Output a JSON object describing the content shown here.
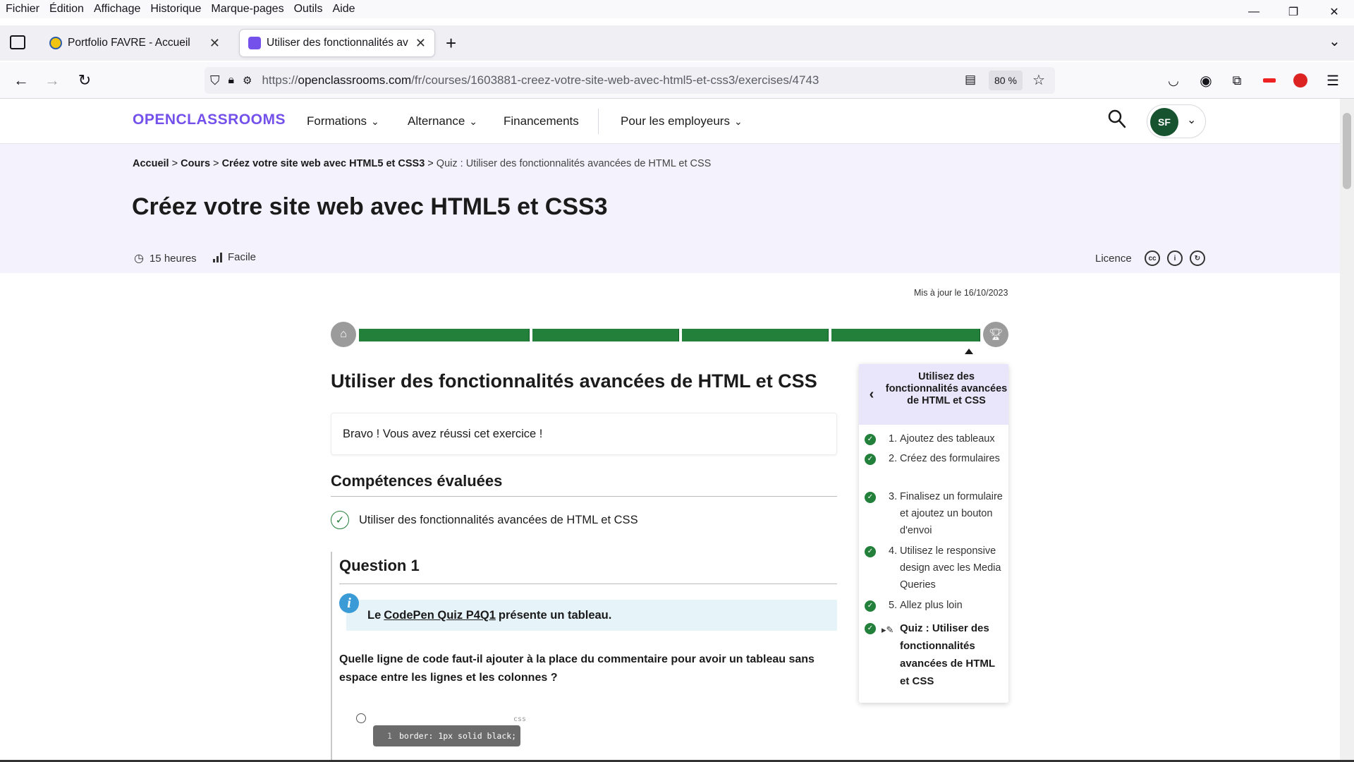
{
  "menu": [
    "Fichier",
    "Édition",
    "Affichage",
    "Historique",
    "Marque-pages",
    "Outils",
    "Aide"
  ],
  "window": {
    "minimize": "—",
    "restore": "❐",
    "close": "✕"
  },
  "tabs": [
    {
      "title": "Portfolio FAVRE - Accueil",
      "favicon_color": "#f1c40f"
    },
    {
      "title": "Utiliser des fonctionnalités avancées de HTML et CSS",
      "favicon_color": "#7451eb"
    }
  ],
  "urlbar": {
    "prefix": "https://",
    "domain": "openclassrooms.com",
    "path": "/fr/courses/1603881-creez-votre-site-web-avec-html5-et-css3/exercises/4743",
    "zoom": "80 %"
  },
  "header": {
    "logo": "OPENCLASSROOMS",
    "nav": [
      "Formations",
      "Alternance",
      "Financements",
      "Pour les employeurs"
    ],
    "avatar_initials": "SF"
  },
  "hero": {
    "breadcrumb": [
      "Accueil",
      "Cours",
      "Créez votre site web avec HTML5 et CSS3"
    ],
    "breadcrumb_current": "Quiz : Utiliser des fonctionnalités avancées de HTML et CSS",
    "title": "Créez votre site web avec HTML5 et CSS3",
    "duration": "15 heures",
    "level": "Facile",
    "licence": "Licence"
  },
  "updated": "Mis à jour le 16/10/2023",
  "progress": {
    "completed_fraction": 1.0,
    "parts": 4
  },
  "main": {
    "activity_title": "Utiliser des fonctionnalités avancées de HTML et CSS",
    "success": "Bravo ! Vous avez réussi cet exercice !",
    "skills_heading": "Compétences évaluées",
    "skill": "Utiliser des fonctionnalités avancées de HTML et CSS",
    "question_title": "Question 1",
    "info_before": "Le",
    "info_link": "CodePen Quiz P4Q1",
    "info_after": "présente un tableau.",
    "question_text": "Quelle ligne de code faut-il ajouter à la place du commentaire pour avoir un tableau sans espace entre les lignes et les colonnes ?",
    "code_lang": "css",
    "code_line_no": "1",
    "code": "border: 1px solid black;"
  },
  "toc": {
    "title": "Utilisez des fonctionnalités avancées de HTML et CSS",
    "items": [
      {
        "num": "1.",
        "label": "Ajoutez des tableaux"
      },
      {
        "num": "2.",
        "label": "Créez des formulaires"
      },
      {
        "num": "3.",
        "label": "Finalisez un formulaire et ajoutez un bouton d'envoi"
      },
      {
        "num": "4.",
        "label": "Utilisez le responsive design avec les Media Queries"
      },
      {
        "num": "5.",
        "label": "Allez plus loin"
      }
    ],
    "current": "Quiz : Utiliser des fonctionnalités avancées de HTML et CSS"
  }
}
